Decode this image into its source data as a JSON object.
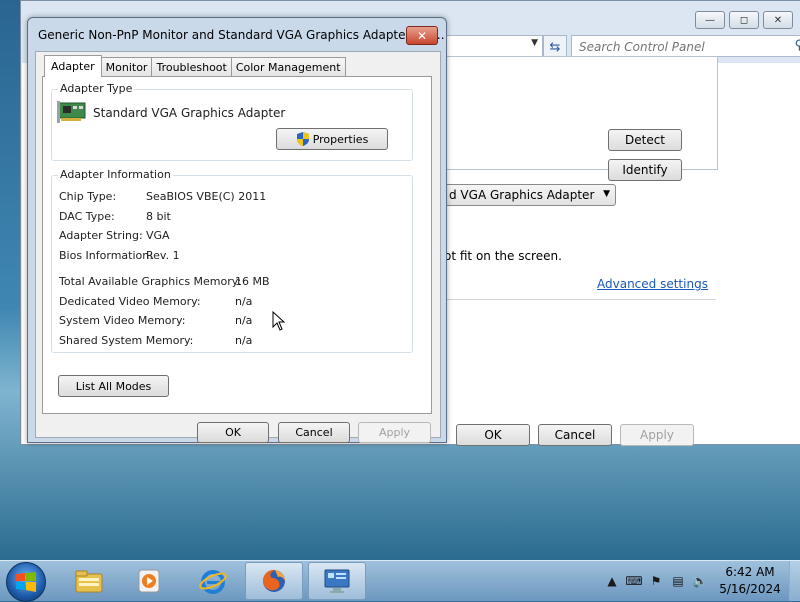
{
  "background_window": {
    "search_placeholder": "Search Control Panel",
    "detect_label": "Detect",
    "identify_label": "Identify",
    "display_select_value": "d VGA Graphics Adapter",
    "fit_text": "ot fit on the screen.",
    "advanced_link": "Advanced settings",
    "ok_label": "OK",
    "cancel_label": "Cancel",
    "apply_label": "Apply"
  },
  "dialog": {
    "title": "Generic Non-PnP Monitor and Standard VGA Graphics Adapter Pro...",
    "tabs": [
      {
        "label": "Adapter",
        "active": true
      },
      {
        "label": "Monitor",
        "active": false
      },
      {
        "label": "Troubleshoot",
        "active": false
      },
      {
        "label": "Color Management",
        "active": false
      }
    ],
    "adapter_type": {
      "legend": "Adapter Type",
      "name": "Standard VGA Graphics Adapter",
      "properties_label": "Properties"
    },
    "adapter_info": {
      "legend": "Adapter Information",
      "rows": [
        {
          "label": "Chip Type:",
          "value": "SeaBIOS VBE(C) 2011"
        },
        {
          "label": "DAC Type:",
          "value": "8 bit"
        },
        {
          "label": "Adapter String:",
          "value": "VGA"
        },
        {
          "label": "Bios Information:",
          "value": "Rev. 1"
        }
      ],
      "memory": [
        {
          "label": "Total Available Graphics Memory:",
          "value": "16 MB"
        },
        {
          "label": "Dedicated Video Memory:",
          "value": "n/a"
        },
        {
          "label": "System Video Memory:",
          "value": "n/a"
        },
        {
          "label": "Shared System Memory:",
          "value": "n/a"
        }
      ]
    },
    "list_all_modes_label": "List All Modes",
    "ok_label": "OK",
    "cancel_label": "Cancel",
    "apply_label": "Apply"
  },
  "taskbar": {
    "time": "6:42 AM",
    "date": "5/16/2024",
    "pinned": [
      "file-explorer-icon",
      "media-player-icon",
      "internet-explorer-icon",
      "firefox-icon",
      "control-panel-icon"
    ]
  }
}
